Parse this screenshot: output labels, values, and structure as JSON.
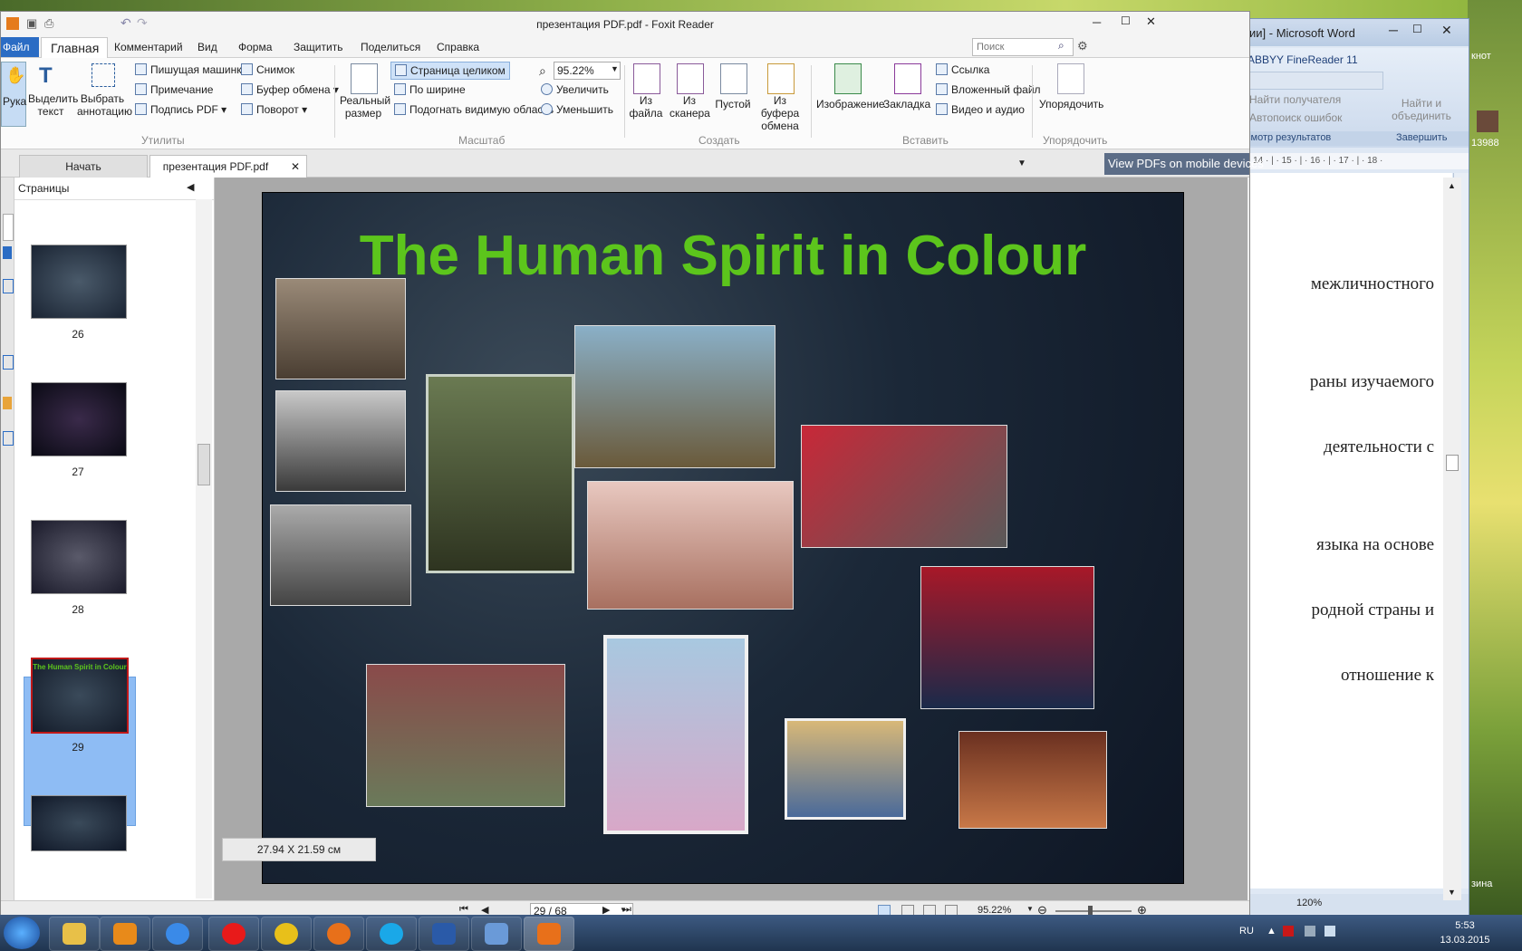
{
  "foxit": {
    "title": "презентация PDF.pdf - Foxit Reader",
    "menu": {
      "file": "Файл",
      "home": "Главная",
      "comment": "Комментарий",
      "view": "Вид",
      "form": "Форма",
      "protect": "Защитить",
      "share": "Поделиться",
      "help": "Справка"
    },
    "search_placeholder": "Поиск",
    "ribbon": {
      "hand": "Рука",
      "select_text": "Выделить текст",
      "select_annot": "Выбрать аннотацию",
      "typewriter": "Пишущая машинка",
      "note": "Примечание",
      "sign": "Подпись PDF",
      "snapshot": "Снимок",
      "clipboard": "Буфер обмена",
      "rotate": "Поворот",
      "utilities": "Утилиты",
      "actual_size": "Реальный размер",
      "fit_page": "Страница целиком",
      "fit_width": "По ширине",
      "fit_visible": "Подогнать видимую область",
      "zoom_value": "95.22%",
      "zoom_in": "Увеличить",
      "zoom_out": "Уменьшить",
      "scale": "Масштаб",
      "from_file": "Из файла",
      "from_scanner": "Из сканера",
      "blank": "Пустой",
      "from_clipboard": "Из буфера обмена",
      "create": "Создать",
      "image": "Изображение",
      "bookmark": "Закладка",
      "link": "Ссылка",
      "attachment": "Вложенный файл",
      "video": "Видео и аудио",
      "insert": "Вставить",
      "arrange": "Упорядочить",
      "arrange_group": "Упорядочить"
    },
    "tabs": {
      "start": "Начать",
      "doc": "презентация PDF.pdf"
    },
    "mobile_banner": "View PDFs on mobile devices",
    "pages_label": "Страницы",
    "thumbnails": [
      {
        "num": "26"
      },
      {
        "num": "27"
      },
      {
        "num": "28"
      },
      {
        "num": "29"
      }
    ],
    "slide_title": "The Human Spirit in Colour",
    "page_size": "27.94 X 21.59 см",
    "page_indicator": "29 / 68",
    "status_zoom": "95.22%"
  },
  "word": {
    "title": "ии] - Microsoft Word",
    "finereader": "ABBYY FineReader 11",
    "find_recipient": "Найти получателя",
    "autosearch": "Автопоиск ошибок",
    "find_merge": "Найти и объединить",
    "view_results": "смотр результатов",
    "finish": "Завершить",
    "ruler": "· 14 · | · 15 · | · 16 · | · 17 · | · 18 ·",
    "lines": [
      "межличностного",
      "раны изучаемого",
      "деятельности с",
      "языка на основе",
      "родной страны и",
      "отношение к"
    ],
    "zoom": "120%"
  },
  "desktop": {
    "label_top": "кнот",
    "label_mid": "13988",
    "label_bottom": "зина"
  },
  "taskbar": {
    "lang": "RU",
    "time": "5:53",
    "date": "13.03.2015"
  },
  "colors": {
    "accent": "#2b6cc4",
    "title_green": "#5cc51c",
    "selection": "#8ebcf4"
  }
}
